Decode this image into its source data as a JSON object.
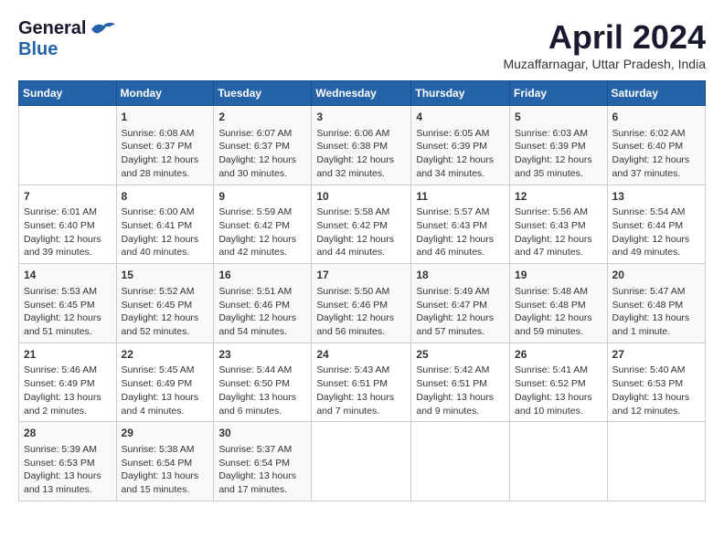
{
  "header": {
    "logo_general": "General",
    "logo_blue": "Blue",
    "month": "April 2024",
    "location": "Muzaffarnagar, Uttar Pradesh, India"
  },
  "weekdays": [
    "Sunday",
    "Monday",
    "Tuesday",
    "Wednesday",
    "Thursday",
    "Friday",
    "Saturday"
  ],
  "weeks": [
    [
      {
        "day": "",
        "sunrise": "",
        "sunset": "",
        "daylight": ""
      },
      {
        "day": "1",
        "sunrise": "Sunrise: 6:08 AM",
        "sunset": "Sunset: 6:37 PM",
        "daylight": "Daylight: 12 hours and 28 minutes."
      },
      {
        "day": "2",
        "sunrise": "Sunrise: 6:07 AM",
        "sunset": "Sunset: 6:37 PM",
        "daylight": "Daylight: 12 hours and 30 minutes."
      },
      {
        "day": "3",
        "sunrise": "Sunrise: 6:06 AM",
        "sunset": "Sunset: 6:38 PM",
        "daylight": "Daylight: 12 hours and 32 minutes."
      },
      {
        "day": "4",
        "sunrise": "Sunrise: 6:05 AM",
        "sunset": "Sunset: 6:39 PM",
        "daylight": "Daylight: 12 hours and 34 minutes."
      },
      {
        "day": "5",
        "sunrise": "Sunrise: 6:03 AM",
        "sunset": "Sunset: 6:39 PM",
        "daylight": "Daylight: 12 hours and 35 minutes."
      },
      {
        "day": "6",
        "sunrise": "Sunrise: 6:02 AM",
        "sunset": "Sunset: 6:40 PM",
        "daylight": "Daylight: 12 hours and 37 minutes."
      }
    ],
    [
      {
        "day": "7",
        "sunrise": "Sunrise: 6:01 AM",
        "sunset": "Sunset: 6:40 PM",
        "daylight": "Daylight: 12 hours and 39 minutes."
      },
      {
        "day": "8",
        "sunrise": "Sunrise: 6:00 AM",
        "sunset": "Sunset: 6:41 PM",
        "daylight": "Daylight: 12 hours and 40 minutes."
      },
      {
        "day": "9",
        "sunrise": "Sunrise: 5:59 AM",
        "sunset": "Sunset: 6:42 PM",
        "daylight": "Daylight: 12 hours and 42 minutes."
      },
      {
        "day": "10",
        "sunrise": "Sunrise: 5:58 AM",
        "sunset": "Sunset: 6:42 PM",
        "daylight": "Daylight: 12 hours and 44 minutes."
      },
      {
        "day": "11",
        "sunrise": "Sunrise: 5:57 AM",
        "sunset": "Sunset: 6:43 PM",
        "daylight": "Daylight: 12 hours and 46 minutes."
      },
      {
        "day": "12",
        "sunrise": "Sunrise: 5:56 AM",
        "sunset": "Sunset: 6:43 PM",
        "daylight": "Daylight: 12 hours and 47 minutes."
      },
      {
        "day": "13",
        "sunrise": "Sunrise: 5:54 AM",
        "sunset": "Sunset: 6:44 PM",
        "daylight": "Daylight: 12 hours and 49 minutes."
      }
    ],
    [
      {
        "day": "14",
        "sunrise": "Sunrise: 5:53 AM",
        "sunset": "Sunset: 6:45 PM",
        "daylight": "Daylight: 12 hours and 51 minutes."
      },
      {
        "day": "15",
        "sunrise": "Sunrise: 5:52 AM",
        "sunset": "Sunset: 6:45 PM",
        "daylight": "Daylight: 12 hours and 52 minutes."
      },
      {
        "day": "16",
        "sunrise": "Sunrise: 5:51 AM",
        "sunset": "Sunset: 6:46 PM",
        "daylight": "Daylight: 12 hours and 54 minutes."
      },
      {
        "day": "17",
        "sunrise": "Sunrise: 5:50 AM",
        "sunset": "Sunset: 6:46 PM",
        "daylight": "Daylight: 12 hours and 56 minutes."
      },
      {
        "day": "18",
        "sunrise": "Sunrise: 5:49 AM",
        "sunset": "Sunset: 6:47 PM",
        "daylight": "Daylight: 12 hours and 57 minutes."
      },
      {
        "day": "19",
        "sunrise": "Sunrise: 5:48 AM",
        "sunset": "Sunset: 6:48 PM",
        "daylight": "Daylight: 12 hours and 59 minutes."
      },
      {
        "day": "20",
        "sunrise": "Sunrise: 5:47 AM",
        "sunset": "Sunset: 6:48 PM",
        "daylight": "Daylight: 13 hours and 1 minute."
      }
    ],
    [
      {
        "day": "21",
        "sunrise": "Sunrise: 5:46 AM",
        "sunset": "Sunset: 6:49 PM",
        "daylight": "Daylight: 13 hours and 2 minutes."
      },
      {
        "day": "22",
        "sunrise": "Sunrise: 5:45 AM",
        "sunset": "Sunset: 6:49 PM",
        "daylight": "Daylight: 13 hours and 4 minutes."
      },
      {
        "day": "23",
        "sunrise": "Sunrise: 5:44 AM",
        "sunset": "Sunset: 6:50 PM",
        "daylight": "Daylight: 13 hours and 6 minutes."
      },
      {
        "day": "24",
        "sunrise": "Sunrise: 5:43 AM",
        "sunset": "Sunset: 6:51 PM",
        "daylight": "Daylight: 13 hours and 7 minutes."
      },
      {
        "day": "25",
        "sunrise": "Sunrise: 5:42 AM",
        "sunset": "Sunset: 6:51 PM",
        "daylight": "Daylight: 13 hours and 9 minutes."
      },
      {
        "day": "26",
        "sunrise": "Sunrise: 5:41 AM",
        "sunset": "Sunset: 6:52 PM",
        "daylight": "Daylight: 13 hours and 10 minutes."
      },
      {
        "day": "27",
        "sunrise": "Sunrise: 5:40 AM",
        "sunset": "Sunset: 6:53 PM",
        "daylight": "Daylight: 13 hours and 12 minutes."
      }
    ],
    [
      {
        "day": "28",
        "sunrise": "Sunrise: 5:39 AM",
        "sunset": "Sunset: 6:53 PM",
        "daylight": "Daylight: 13 hours and 13 minutes."
      },
      {
        "day": "29",
        "sunrise": "Sunrise: 5:38 AM",
        "sunset": "Sunset: 6:54 PM",
        "daylight": "Daylight: 13 hours and 15 minutes."
      },
      {
        "day": "30",
        "sunrise": "Sunrise: 5:37 AM",
        "sunset": "Sunset: 6:54 PM",
        "daylight": "Daylight: 13 hours and 17 minutes."
      },
      {
        "day": "",
        "sunrise": "",
        "sunset": "",
        "daylight": ""
      },
      {
        "day": "",
        "sunrise": "",
        "sunset": "",
        "daylight": ""
      },
      {
        "day": "",
        "sunrise": "",
        "sunset": "",
        "daylight": ""
      },
      {
        "day": "",
        "sunrise": "",
        "sunset": "",
        "daylight": ""
      }
    ]
  ]
}
